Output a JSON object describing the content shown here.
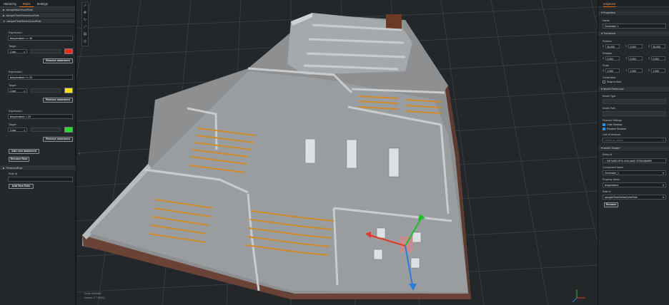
{
  "left_panel": {
    "tabs": [
      "Hierarchy",
      "Rules",
      "Settings"
    ],
    "rules": [
      {
        "id": "sampleAlarmIconRule",
        "expanded": false
      },
      {
        "id": "sampleTimeSeriesIconRule",
        "expanded": false
      },
      {
        "id": "sampleTimeSeriesColorRule",
        "expanded": true
      }
    ],
    "statements": [
      {
        "expression_label": "Expression",
        "expression": "temperature >= 40",
        "target_label": "Target",
        "target_type": "Color",
        "color": "#e8321e",
        "remove_label": "Remove statement"
      },
      {
        "expression_label": "Expression",
        "expression": "temperature >= 20",
        "target_label": "Target",
        "target_type": "Color",
        "color": "#ffe11a",
        "remove_label": "Remove statement"
      },
      {
        "expression_label": "Expression",
        "expression": "temperature < 20",
        "target_label": "Target",
        "target_type": "Color",
        "color": "#25e02a",
        "remove_label": "Remove statement"
      }
    ],
    "add_statement": "Add new statement",
    "remove_rule": "Remove Rule",
    "pressure_rule": "PressureRule",
    "rule_id_label": "Rule Id",
    "add_rule": "Add New Rule"
  },
  "viewport": {
    "caption_line1": "Grasp Selected",
    "caption_line2": "Version: 0.7.0b(02)"
  },
  "right_panel": {
    "title": "Inspector",
    "properties_header": "Properties",
    "name_label": "Name",
    "name_value": "Generator 1",
    "transform_header": "Transform",
    "position_label": "Position",
    "position": {
      "x": "30.000",
      "y": "0.000",
      "z": "30.000"
    },
    "rotation_label": "Rotation",
    "rotation": {
      "x": "0.000",
      "y": "0.000",
      "z": "0.000"
    },
    "scale_label": "Scale",
    "scale": {
      "x": "1.000",
      "y": "1.000",
      "z": "1.000"
    },
    "constraints_label": "Constraints",
    "snap_label": "Snap to floor",
    "model_ref_header": "Model Reference",
    "model_type_label": "Model Type",
    "model_path_label": "Model Path",
    "shadow_label": "Shadow Settings",
    "cast_shadow": "Cast Shadow",
    "receive_shadow": "Receive Shadow",
    "unit_label": "Unit of Measure",
    "unit_placeholder": "Select an option",
    "model_shader_header": "Model Shader",
    "entity_label": "Entity Id",
    "entity_value": "3007a052-097e-4e1d-abd0-37254166d969",
    "component_label": "Component Name",
    "component_value": "Generator_1",
    "property_label": "Property Name",
    "property_value": "temperature",
    "rule_id_label": "Rule Id",
    "rule_id_value": "sampleTimeSeriesColorRule",
    "remove_label": "Remove"
  }
}
